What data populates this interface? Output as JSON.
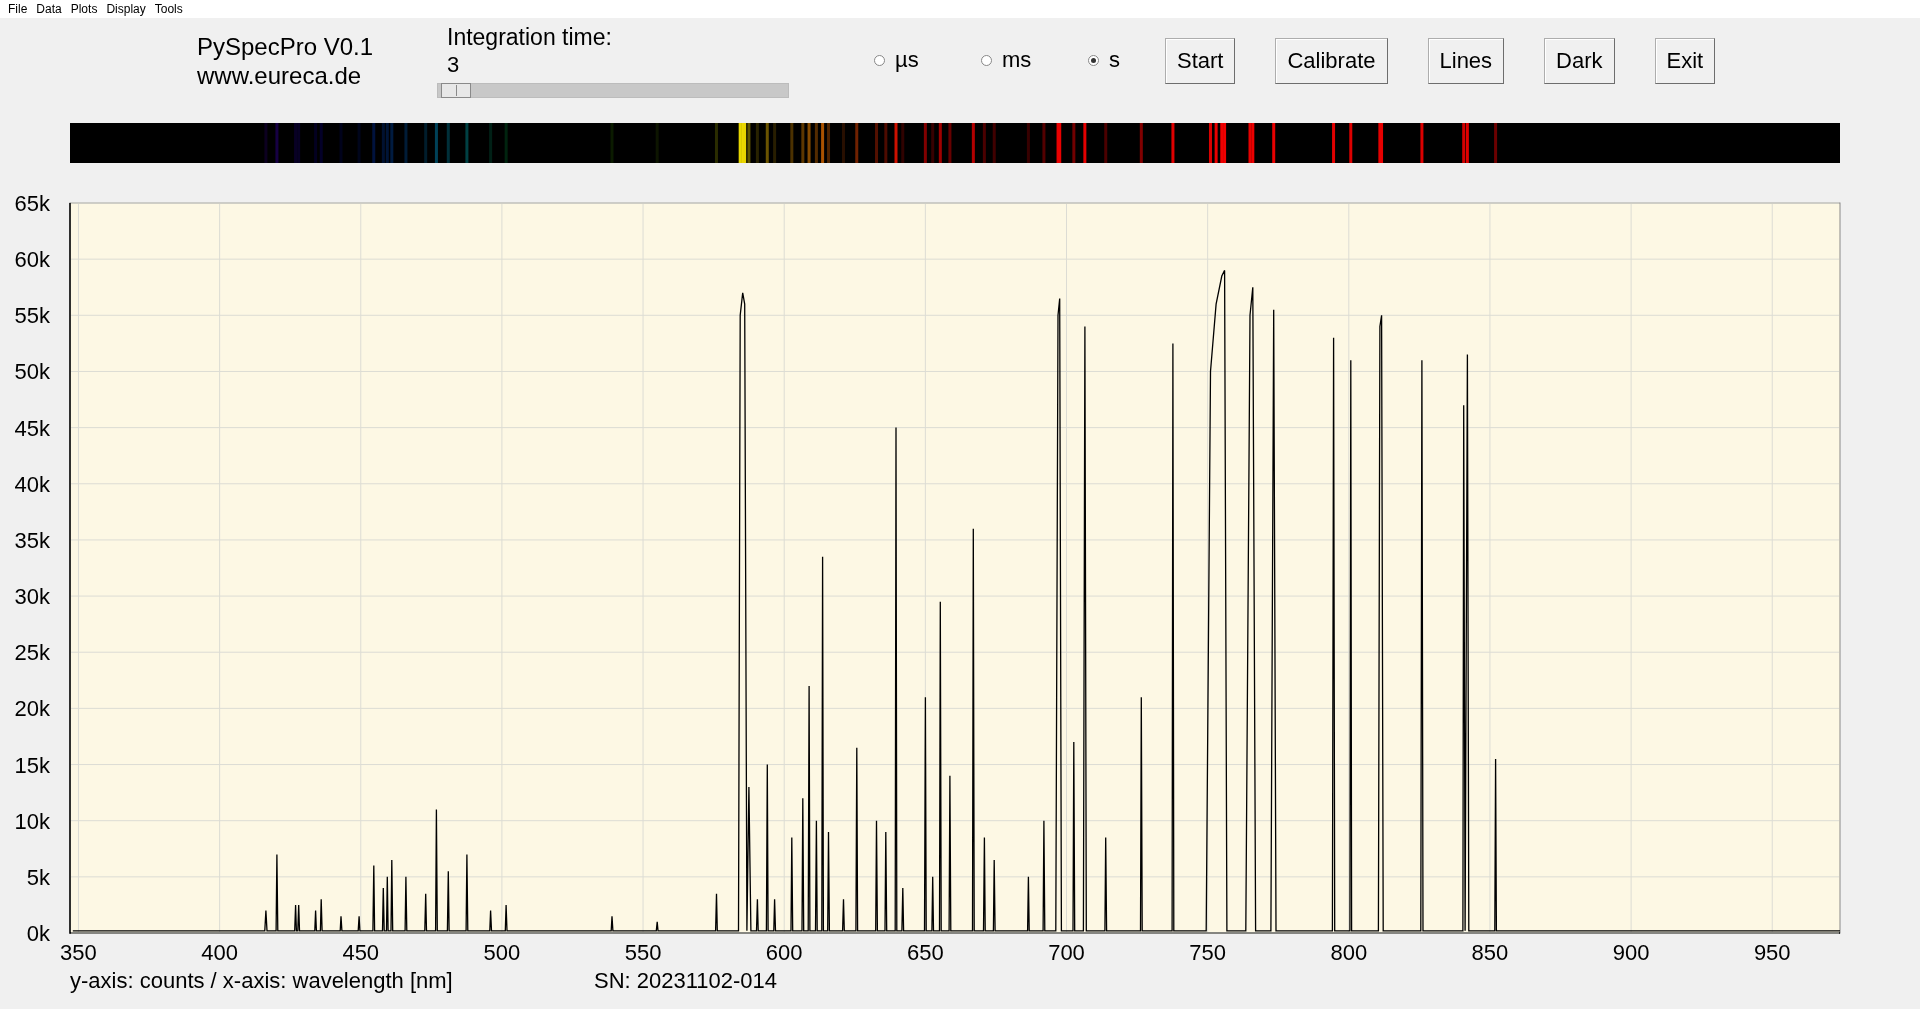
{
  "menu": [
    {
      "label": "File"
    },
    {
      "label": "Data"
    },
    {
      "label": "Plots"
    },
    {
      "label": "Display"
    },
    {
      "label": "Tools"
    }
  ],
  "app": {
    "title": "PySpecPro V0.1",
    "url": "www.eureca.de"
  },
  "integration": {
    "label": "Integration time:",
    "value": "3",
    "level": 0.01
  },
  "units": [
    {
      "label": "µs",
      "selected": false
    },
    {
      "label": "ms",
      "selected": false
    },
    {
      "label": "s",
      "selected": true
    }
  ],
  "buttons": [
    {
      "label": "Start"
    },
    {
      "label": "Calibrate"
    },
    {
      "label": "Lines"
    },
    {
      "label": "Dark"
    },
    {
      "label": "Exit"
    }
  ],
  "chart_data": {
    "type": "line",
    "grid": true,
    "xlim": [
      347,
      974
    ],
    "ylim": [
      0,
      65000
    ],
    "xticks": [
      350,
      400,
      450,
      500,
      550,
      600,
      650,
      700,
      750,
      800,
      850,
      900,
      950
    ],
    "yticks": [
      {
        "value": 0,
        "label": "0k"
      },
      {
        "value": 5000,
        "label": "5k"
      },
      {
        "value": 10000,
        "label": "10k"
      },
      {
        "value": 15000,
        "label": "15k"
      },
      {
        "value": 20000,
        "label": "20k"
      },
      {
        "value": 25000,
        "label": "25k"
      },
      {
        "value": 30000,
        "label": "30k"
      },
      {
        "value": 35000,
        "label": "35k"
      },
      {
        "value": 40000,
        "label": "40k"
      },
      {
        "value": 45000,
        "label": "45k"
      },
      {
        "value": 50000,
        "label": "50k"
      },
      {
        "value": 55000,
        "label": "55k"
      },
      {
        "value": 60000,
        "label": "60k"
      },
      {
        "value": 65000,
        "label": "65k"
      }
    ],
    "x": [
      348,
      416,
      416.4,
      416.8,
      420,
      420.3,
      420.6,
      426.6,
      426.9,
      427.2,
      427.7,
      428,
      428.3,
      433.7,
      434,
      434.3,
      435.7,
      436,
      436.3,
      442.7,
      443,
      443.3,
      449.1,
      449.4,
      449.7,
      454.3,
      454.6,
      454.9,
      457.7,
      458,
      458.3,
      459.1,
      459.4,
      459.7,
      460.7,
      461,
      461.3,
      465.7,
      466,
      466.3,
      472.7,
      473,
      473.3,
      476.5,
      476.8,
      477.1,
      480.7,
      481,
      481.3,
      487.3,
      487.6,
      487.9,
      495.7,
      496,
      496.3,
      501.2,
      501.5,
      501.8,
      538.7,
      539,
      539.3,
      554.7,
      555,
      555.3,
      575.7,
      576,
      576.3,
      583.8,
      584.4,
      585.3,
      586,
      586.8,
      587.5,
      588.2,
      590.2,
      590.5,
      590.8,
      593.7,
      594,
      594.3,
      596.3,
      596.6,
      596.9,
      602.4,
      602.7,
      603,
      606.3,
      606.6,
      606.9,
      608.5,
      608.8,
      609.1,
      611.1,
      611.4,
      611.7,
      613.3,
      613.6,
      613.9,
      615.4,
      615.7,
      616,
      620.7,
      621,
      621.3,
      625.4,
      625.7,
      626,
      632.4,
      632.7,
      633,
      635.7,
      636,
      636.3,
      639.3,
      639.6,
      639.9,
      641.7,
      642,
      642.3,
      649.7,
      650,
      650.3,
      652.3,
      652.6,
      652.9,
      655,
      655.3,
      655.6,
      658.4,
      658.7,
      659,
      666.7,
      667,
      667.3,
      670.6,
      670.9,
      671.2,
      674.1,
      674.4,
      674.7,
      686.2,
      686.5,
      686.8,
      691.7,
      692,
      692.3,
      696.2,
      697,
      697.6,
      698.2,
      702.3,
      702.6,
      702.9,
      706,
      706.5,
      707,
      713.6,
      713.9,
      714.2,
      726.2,
      726.5,
      726.8,
      737.4,
      737.7,
      738,
      749.5,
      751,
      753,
      755,
      756,
      756.8,
      763.5,
      765,
      766,
      767,
      772.4,
      773.4,
      774.2,
      794.2,
      794.6,
      795,
      800.4,
      800.7,
      801,
      810.5,
      811,
      811.6,
      812.2,
      825.5,
      825.9,
      826.3,
      840.4,
      840.7,
      841.2,
      842,
      842.5,
      851.7,
      852,
      852.3,
      974
    ],
    "series": [
      {
        "color": "#000000",
        "values": [
          200,
          200,
          2000,
          200,
          200,
          7000,
          200,
          200,
          2500,
          200,
          200,
          2500,
          200,
          200,
          2000,
          200,
          200,
          3000,
          200,
          200,
          1500,
          200,
          200,
          1500,
          200,
          200,
          6000,
          200,
          200,
          4000,
          200,
          200,
          5000,
          200,
          200,
          6500,
          200,
          200,
          5000,
          200,
          200,
          3500,
          200,
          200,
          11000,
          200,
          200,
          5500,
          200,
          200,
          7000,
          200,
          200,
          2000,
          200,
          200,
          2500,
          200,
          200,
          1500,
          200,
          200,
          1000,
          200,
          200,
          3500,
          200,
          200,
          55000,
          57000,
          56000,
          200,
          13000,
          200,
          200,
          3000,
          200,
          200,
          15000,
          200,
          200,
          3000,
          200,
          200,
          8500,
          200,
          200,
          12000,
          200,
          200,
          22000,
          200,
          200,
          10000,
          200,
          200,
          33500,
          200,
          200,
          9000,
          200,
          200,
          3000,
          200,
          200,
          16500,
          200,
          200,
          10000,
          200,
          200,
          9000,
          200,
          200,
          45000,
          200,
          200,
          4000,
          200,
          200,
          21000,
          200,
          200,
          5000,
          200,
          200,
          29500,
          200,
          200,
          14000,
          200,
          200,
          36000,
          200,
          200,
          8500,
          200,
          200,
          6500,
          200,
          200,
          5000,
          200,
          200,
          10000,
          200,
          200,
          55000,
          56500,
          200,
          200,
          17000,
          200,
          200,
          54000,
          200,
          200,
          8500,
          200,
          200,
          21000,
          200,
          200,
          52500,
          200,
          200,
          50000,
          56000,
          58500,
          59000,
          200,
          200,
          55000,
          57500,
          200,
          200,
          55500,
          200,
          200,
          53000,
          200,
          200,
          51000,
          200,
          200,
          54000,
          55000,
          200,
          200,
          51000,
          200,
          200,
          47000,
          200,
          51500,
          200,
          200,
          15500,
          200,
          200
        ]
      }
    ]
  },
  "footer": {
    "axes_note": "y-axis: counts / x-axis: wavelength [nm]",
    "serial": "SN: 20231102-014"
  }
}
